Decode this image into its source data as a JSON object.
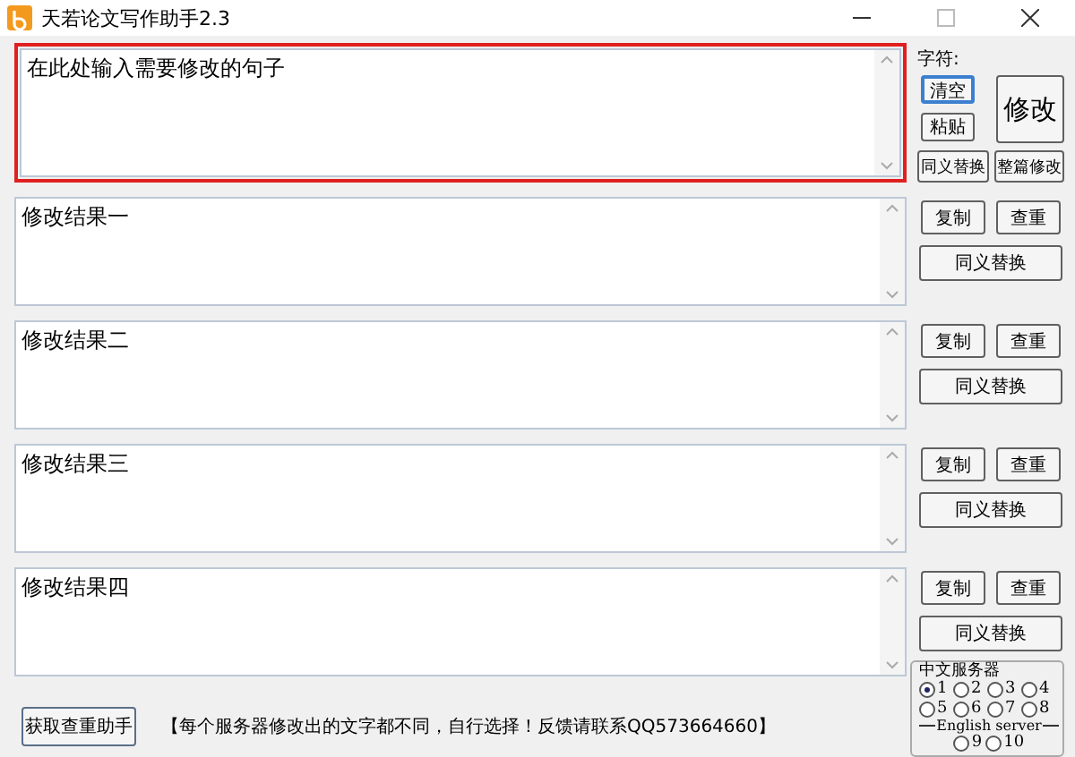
{
  "window": {
    "title": "天若论文写作助手2.3"
  },
  "input": {
    "value": "在此处输入需要修改的句子",
    "focused": true
  },
  "controls": {
    "label": "字符:",
    "buttons": [
      {
        "label": "清空",
        "default": true
      },
      {
        "label": "粘贴",
        "default": false
      },
      {
        "label": "同义替换",
        "default": false
      },
      {
        "label": "整篇修改",
        "default": false
      }
    ],
    "main_button": "修改"
  },
  "results": [
    {
      "value": "修改结果一",
      "buttons": [
        "复制",
        "查重",
        "同义替换"
      ]
    },
    {
      "value": "修改结果二",
      "buttons": [
        "复制",
        "查重",
        "同义替换"
      ]
    },
    {
      "value": "修改结果三",
      "buttons": [
        "复制",
        "查重",
        "同义替换"
      ]
    },
    {
      "value": "修改结果四",
      "buttons": [
        "复制",
        "查重",
        "同义替换"
      ]
    }
  ],
  "footer": {
    "button": "获取查重助手",
    "notice": "【每个服务器修改出的文字都不同，自行选择！反馈请联系QQ573664660】"
  },
  "servers": {
    "title": "中文服务器",
    "items": [
      {
        "label": "1",
        "selected": true
      },
      {
        "label": "2",
        "selected": false
      },
      {
        "label": "3",
        "selected": false
      },
      {
        "label": "4",
        "selected": false
      },
      {
        "label": "5",
        "selected": false
      },
      {
        "label": "6",
        "selected": false
      },
      {
        "label": "7",
        "selected": false
      },
      {
        "label": "8",
        "selected": false
      }
    ],
    "english_title": "English server",
    "english_items": [
      {
        "label": "9",
        "selected": false
      },
      {
        "label": "10",
        "selected": false
      }
    ]
  }
}
